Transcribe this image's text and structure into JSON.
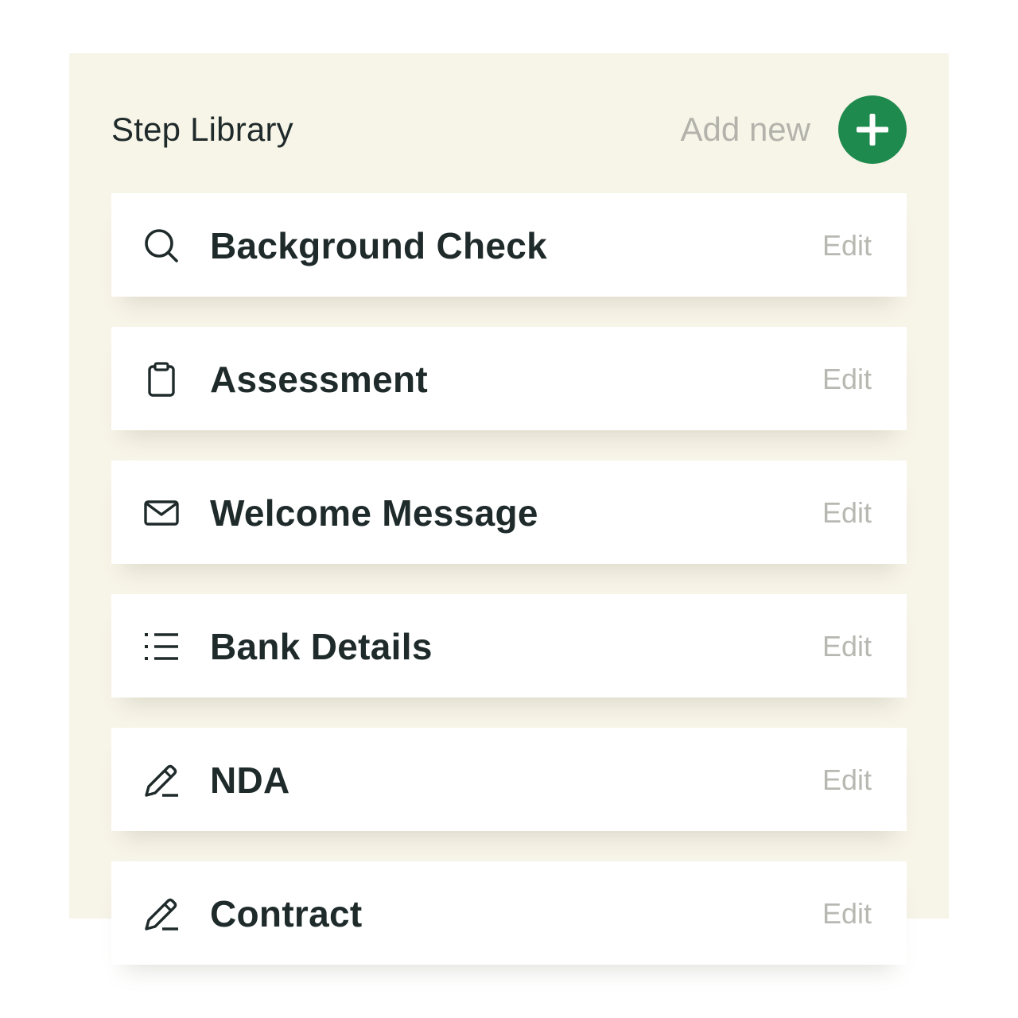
{
  "header": {
    "title": "Step Library",
    "add_label": "Add new"
  },
  "steps": [
    {
      "label": "Background Check",
      "icon": "search-icon",
      "edit_label": "Edit"
    },
    {
      "label": "Assessment",
      "icon": "clipboard-icon",
      "edit_label": "Edit"
    },
    {
      "label": "Welcome Message",
      "icon": "envelope-icon",
      "edit_label": "Edit"
    },
    {
      "label": "Bank Details",
      "icon": "list-icon",
      "edit_label": "Edit"
    },
    {
      "label": "NDA",
      "icon": "pen-icon",
      "edit_label": "Edit"
    },
    {
      "label": "Contract",
      "icon": "pen-icon",
      "edit_label": "Edit"
    }
  ],
  "colors": {
    "panel_background": "#f7f4e8",
    "accent_green": "#1f8a4e",
    "text_dark": "#1f2a2a",
    "text_muted": "#b3b3ab"
  }
}
